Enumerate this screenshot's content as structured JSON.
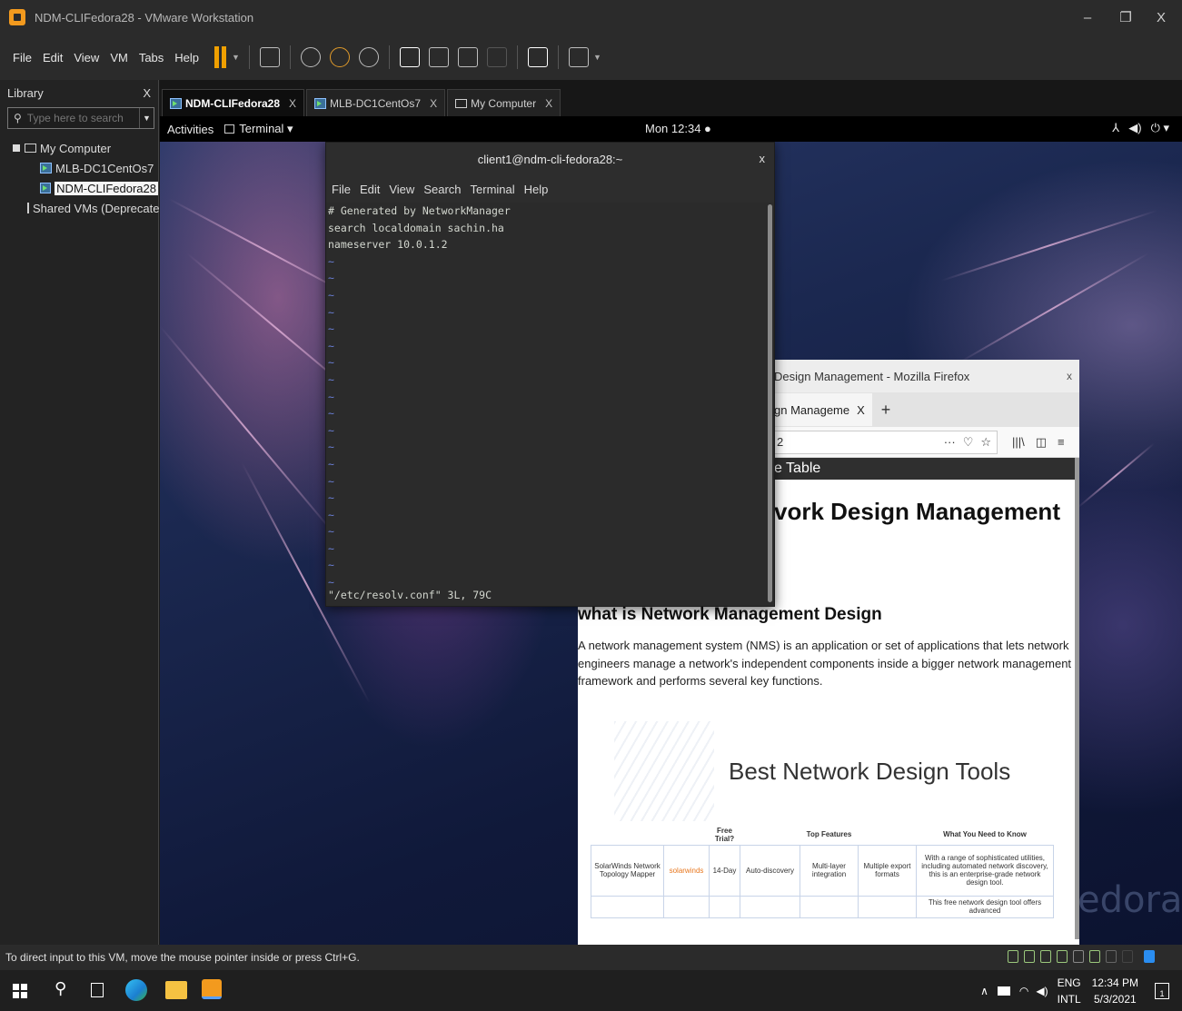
{
  "window": {
    "title": "NDM-CLIFedora28 - VMware Workstation",
    "minimize": "–",
    "maximize": "❐",
    "close": "X"
  },
  "menu": [
    "File",
    "Edit",
    "View",
    "VM",
    "Tabs",
    "Help"
  ],
  "library": {
    "title": "Library",
    "close": "X",
    "search_placeholder": "Type here to search",
    "items": [
      {
        "label": "My Computer"
      },
      {
        "label": "MLB-DC1CentOs7"
      },
      {
        "label": "NDM-CLIFedora28"
      },
      {
        "label": "Shared VMs (Deprecated)"
      }
    ]
  },
  "tabs": [
    {
      "label": "NDM-CLIFedora28",
      "close": "X"
    },
    {
      "label": "MLB-DC1CentOs7",
      "close": "X"
    },
    {
      "label": "My Computer",
      "close": "X"
    }
  ],
  "gnome": {
    "activities": "Activities",
    "terminal_menu": "Terminal ▾",
    "clock": "Mon 12:34 ●",
    "status": [
      "⅄",
      "◀)",
      "⏻ ▾"
    ]
  },
  "terminal": {
    "title": "client1@ndm-cli-fedora28:~",
    "close": "x",
    "menu": [
      "File",
      "Edit",
      "View",
      "Search",
      "Terminal",
      "Help"
    ],
    "lines": [
      "# Generated by NetworkManager",
      "search localdomain sachin.ha",
      "nameserver 10.0.1.2"
    ],
    "tilde": "~",
    "status": "\"/etc/resolv.conf\" 3L, 79C"
  },
  "firefox": {
    "title": "Design Management - Mozilla Firefox",
    "close": "x",
    "tab_label": "gn Manageme",
    "tab_close": "X",
    "newtab": "+",
    "url_text": "2",
    "url_icons": [
      "···",
      "♡",
      "☆"
    ],
    "toolbar_icons": [
      "|||\\",
      "◫",
      "≡"
    ],
    "toc": "e Table",
    "h1": "vork Design Management",
    "h2": "what is Network Management Design",
    "paragraph": "A network management system (NMS) is an application or set of applications that lets network engineers manage a network's independent components inside a bigger network management framework and performs several key functions.",
    "tools_title": "Best Network Design Tools",
    "table": {
      "headers": [
        "",
        "",
        "Free Trial?",
        "",
        "Top Features",
        "",
        "What You Need to Know"
      ],
      "rows": [
        [
          "SolarWinds Network Topology Mapper",
          "solarwinds",
          "14-Day",
          "Auto-discovery",
          "Multi-layer integration",
          "Multiple export formats",
          "With a range of sophisticated utilities, including automated network discovery, this is an enterprise-grade network design tool."
        ],
        [
          "",
          "",
          "",
          "",
          "",
          "",
          "This free network design tool offers advanced"
        ]
      ]
    }
  },
  "watermark": "edora",
  "statusbar": "To direct input to this VM, move the mouse pointer inside or press Ctrl+G.",
  "tray": {
    "lang_top": "ENG",
    "lang_bottom": "INTL",
    "time": "12:34 PM",
    "date": "5/3/2021",
    "notif": "1"
  }
}
